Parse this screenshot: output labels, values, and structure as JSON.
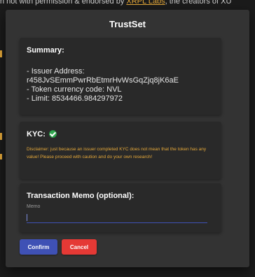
{
  "background": {
    "notice_prefix": "n not with permission & endorsed by ",
    "notice_link": "XRPL Labs",
    "notice_suffix": ", the creators of XU"
  },
  "dialog": {
    "title": "TrustSet",
    "summary": {
      "heading": "Summary:",
      "lines": [
        "- Issuer Address:",
        "r458JvSEmmPwrRbEtmrHvWsGqZjq8jK6aE",
        "- Token currency code: NVL",
        "- Limit: 8534466.984297972"
      ]
    },
    "kyc": {
      "heading": "KYC:",
      "status_icon": "check-circle-icon",
      "disclaimer": "Disclaimer: just because an issuer completed KYC does not mean that the token has any value! Please proceed with caution and do your own research!"
    },
    "memo": {
      "heading": "Transaction Memo (optional):",
      "label": "Memo",
      "value": ""
    },
    "buttons": {
      "confirm": "Confirm",
      "cancel": "Cancel"
    }
  },
  "colors": {
    "accent": "#3f51b5",
    "danger": "#e53935",
    "warning": "#e6a93a",
    "success": "#2fa84f"
  }
}
